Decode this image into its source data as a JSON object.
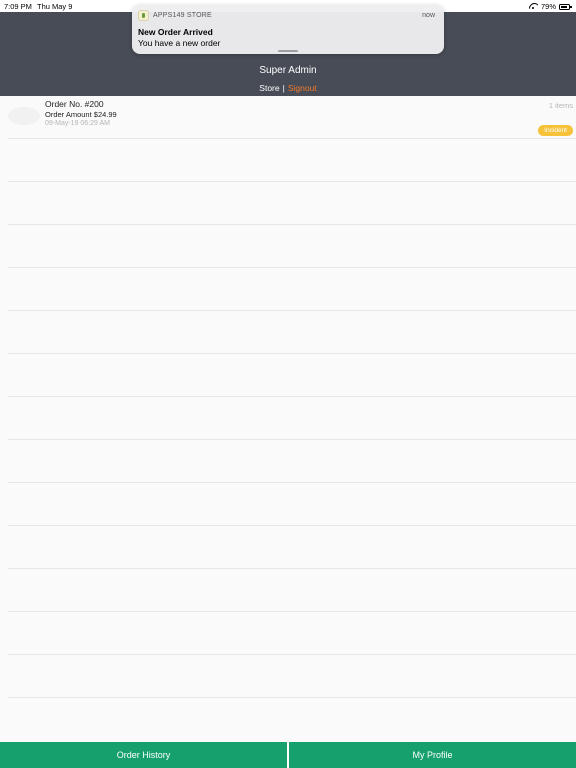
{
  "status_bar": {
    "time": "7:09 PM",
    "date": "Thu May 9",
    "battery": "79%"
  },
  "header": {
    "title": "Super Admin",
    "store_label": "Store",
    "separator": "|",
    "signout_label": "Signout",
    "background_color": "#474c56",
    "signout_color": "#f47a2c"
  },
  "notification": {
    "app_name": "APPS149 STORE",
    "time": "now",
    "title": "New Order Arrived",
    "body": "You have a new order"
  },
  "orders": [
    {
      "number": "Order No. #200",
      "amount": "Order Amount $24.99",
      "date": "09-May-19 06:29 AM",
      "items": "1 items",
      "status": "Incident"
    }
  ],
  "tabs": [
    {
      "label": "Order History"
    },
    {
      "label": "My Profile"
    }
  ],
  "colors": {
    "tab_bar": "#16a06d",
    "status_badge": "#f5c23a"
  }
}
